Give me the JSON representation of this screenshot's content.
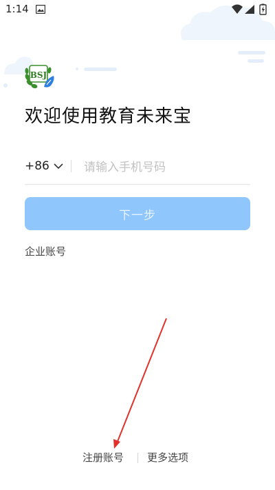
{
  "status_bar": {
    "time": "1:14",
    "icons": [
      "photo-icon",
      "wifi-icon",
      "signal-icon",
      "battery-charging-icon"
    ]
  },
  "app": {
    "logo_text": "BSJ",
    "title": "欢迎使用教育未来宝"
  },
  "phone_form": {
    "country_code": "+86",
    "placeholder": "请输入手机号码",
    "value": "",
    "next_label": "下一步"
  },
  "links": {
    "enterprise": "企业账号",
    "register": "注册账号",
    "more_options": "更多选项"
  },
  "colors": {
    "primary_disabled": "#8fc6fb",
    "annotation": "#e2302a"
  }
}
